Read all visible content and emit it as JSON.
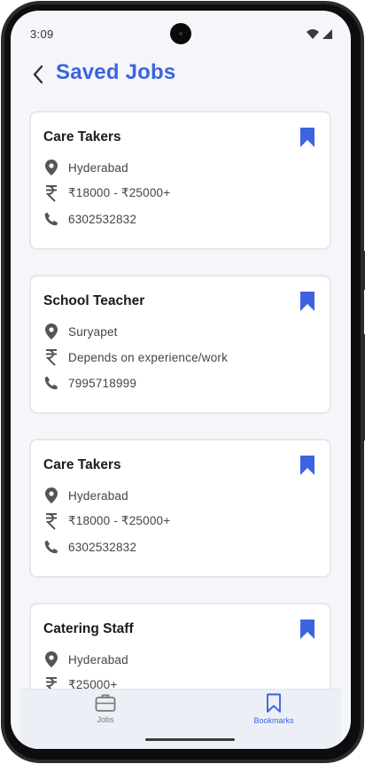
{
  "status_bar": {
    "time": "3:09",
    "icons": [
      "wifi-icon",
      "cellular-signal-icon"
    ]
  },
  "header": {
    "title": "Saved Jobs",
    "back_icon": "chevron-left-icon"
  },
  "jobs": [
    {
      "title": "Care Takers",
      "location": "Hyderabad",
      "salary": "₹18000 - ₹25000+",
      "phone": "6302532832",
      "bookmarked": true
    },
    {
      "title": "School Teacher",
      "location": "Suryapet",
      "salary": "Depends on experience/work",
      "phone": "7995718999",
      "bookmarked": true
    },
    {
      "title": "Care Takers",
      "location": "Hyderabad",
      "salary": "₹18000 - ₹25000+",
      "phone": "6302532832",
      "bookmarked": true
    },
    {
      "title": "Catering Staff",
      "location": "Hyderabad",
      "salary": "₹25000+",
      "phone": "",
      "bookmarked": true
    }
  ],
  "bottom_nav": {
    "items": [
      {
        "label": "Jobs",
        "icon": "briefcase-icon",
        "active": false
      },
      {
        "label": "Bookmarks",
        "icon": "bookmark-icon",
        "active": true
      }
    ]
  },
  "colors": {
    "accent": "#3d63e0",
    "background": "#f4f6f9",
    "card": "#ffffff",
    "text": "#1b1b1b",
    "muted": "#444444"
  }
}
